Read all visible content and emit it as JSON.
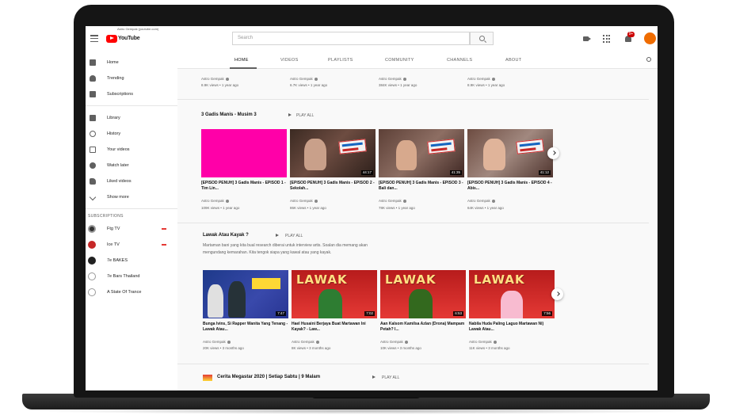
{
  "browser": {
    "url_tooltip": "Astro Gempak (youtube.com)"
  },
  "header": {
    "logo_text": "YouTube",
    "search_placeholder": "Search",
    "notification_count": "9+",
    "avatar_letter": ""
  },
  "sidebar": {
    "items": [
      {
        "label": "Home",
        "icon": "home-icon"
      },
      {
        "label": "Trending",
        "icon": "trending-icon"
      },
      {
        "label": "Subscriptions",
        "icon": "subscriptions-icon"
      },
      {
        "label": "Library",
        "icon": "library-icon"
      },
      {
        "label": "History",
        "icon": "history-icon"
      },
      {
        "label": "Your videos",
        "icon": "your-videos-icon"
      },
      {
        "label": "Watch later",
        "icon": "watch-later-icon"
      },
      {
        "label": "Liked videos",
        "icon": "liked-videos-icon"
      },
      {
        "label": "Show more",
        "icon": "chevron-down-icon"
      }
    ],
    "subscriptions_heading": "SUBSCRIPTIONS",
    "subscriptions": [
      {
        "label": "Ftg TV",
        "color": "#333333",
        "live": true
      },
      {
        "label": "Ice TV",
        "color": "#c62828",
        "live": true
      },
      {
        "label": "7e BAKES",
        "color": "#212121",
        "live": false
      },
      {
        "label": "7e Bars Thailand",
        "color": "#ffffff",
        "live": false
      },
      {
        "label": "A State Of Trance",
        "color": "#ffffff",
        "live": false
      }
    ]
  },
  "tabs": [
    "HOME",
    "VIDEOS",
    "PLAYLISTS",
    "COMMUNITY",
    "CHANNELS",
    "ABOUT"
  ],
  "top_row": [
    {
      "channel": "Astro Gempak",
      "meta": "8.9K views • 1 year ago"
    },
    {
      "channel": "Astro Gempak",
      "meta": "6.7K views • 1 year ago"
    },
    {
      "channel": "Astro Gempak",
      "meta": "384K views • 1 year ago"
    },
    {
      "channel": "Astro Gempak",
      "meta": "8.9K views • 1 year ago"
    }
  ],
  "shelf1": {
    "title": "3 Gadis Manis - Musim 3",
    "play_all": "PLAY ALL",
    "videos": [
      {
        "title": "[EPISOD PENUH] 3 Gadis Manis - EPISOD 1 - Tim Lin...",
        "channel": "Astro Gempak",
        "meta": "109K views • 1 year ago",
        "duration": ""
      },
      {
        "title": "[EPISOD PENUH] 3 Gadis Manis - EPISOD 2 - Sekolah...",
        "channel": "Astro Gempak",
        "meta": "86K views • 1 year ago",
        "duration": "44:17"
      },
      {
        "title": "[EPISOD PENUH] 3 Gadis Manis - EPISOD 3 - Bali dan...",
        "channel": "Astro Gempak",
        "meta": "78K views • 1 year ago",
        "duration": "41:35"
      },
      {
        "title": "[EPISOD PENUH] 3 Gadis Manis - EPISOD 4 - Abis...",
        "channel": "Astro Gempak",
        "meta": "64K views • 1 year ago",
        "duration": "41:12"
      }
    ]
  },
  "shelf2": {
    "title": "Lawak Atau Kayak ?",
    "play_all": "PLAY ALL",
    "desc1": "Martaman bani yang kita bual research diberai untuk interview artis. Soalan dia memang akan",
    "desc2": "mengundang kemarahan. Kita tengok siapa yang kawal atau yang kayak.",
    "videos": [
      {
        "title": "Bunga Ivins, Si Rapper Wanita Yang Tenang - Lawak Atau...",
        "channel": "Astro Gempak",
        "meta": "20K views • 3 months ago",
        "duration": "7:47"
      },
      {
        "title": "Hael Husaini Berjaya Buat Martawan Ini Kayak? - Law...",
        "channel": "Astro Gempak",
        "meta": "8K views • 3 months ago",
        "duration": "7:02"
      },
      {
        "title": "Aan Kalsom Kamilsa Azlan (Drona) Mampam Petah? I...",
        "channel": "Astro Gempak",
        "meta": "10K views • 3 months ago",
        "duration": "6:53"
      },
      {
        "title": "Nabila Huda Paling Laguo Martawan Ni) Lawak Atau...",
        "channel": "Astro Gempak",
        "meta": "11K views • 3 months ago",
        "duration": "7:56"
      }
    ]
  },
  "shelf3": {
    "title": "Cerita Megastar 2020 | Setiap Sabtu | 9 Malam",
    "play_all": "PLAY ALL"
  }
}
